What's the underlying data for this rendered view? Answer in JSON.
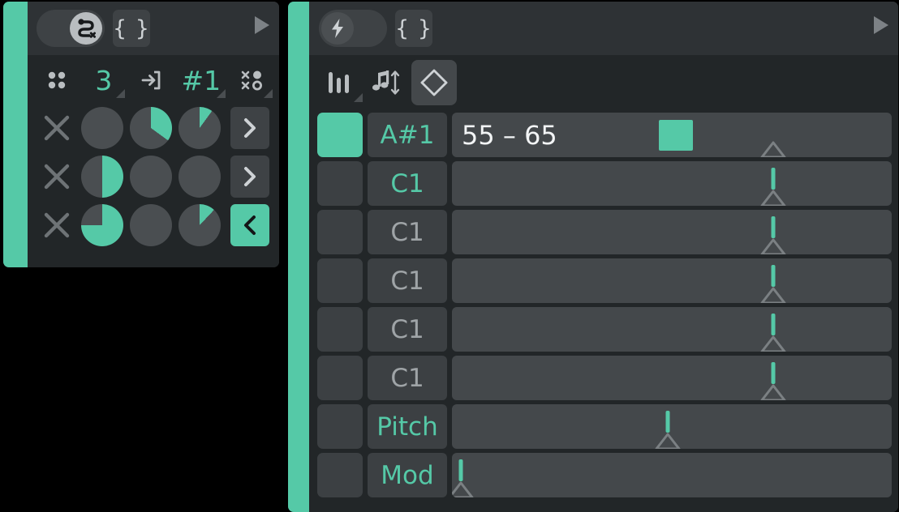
{
  "theme": {
    "accent": "#55c9a7",
    "panel_bg": "#2e3235",
    "body_bg": "#222628",
    "control_bg": "#3e4245",
    "track_bg": "#44484b",
    "text_dim": "#9fa4a7",
    "text_bright": "#f2f4f5",
    "page_bg": "#000000"
  },
  "left_panel": {
    "header": {
      "mod_toggle": {
        "state": "on",
        "icon": "snake-path-x-icon"
      },
      "braces_button": {
        "label": "{ }",
        "icon": "curly-braces-icon"
      },
      "play_button": {
        "icon": "play-triangle-icon"
      }
    },
    "toolbar": [
      {
        "name": "grid",
        "icon": "four-dot-grid-icon",
        "label": "",
        "accent": false
      },
      {
        "name": "count",
        "icon": "",
        "label": "3",
        "accent": true
      },
      {
        "name": "input",
        "icon": "arrow-into-box-icon",
        "label": "",
        "accent": false
      },
      {
        "name": "pattern",
        "icon": "",
        "label": "#1",
        "accent": true
      },
      {
        "name": "randomize",
        "icon": "random-dots-icon",
        "label": "",
        "accent": false
      }
    ],
    "rows": [
      {
        "clear_icon": "close-x-icon",
        "dials": [
          0,
          35,
          10
        ],
        "chevron": {
          "icon": "chevron-right-icon",
          "direction": "right",
          "active": false
        }
      },
      {
        "clear_icon": "close-x-icon",
        "dials": [
          50,
          0,
          0
        ],
        "chevron": {
          "icon": "chevron-right-icon",
          "direction": "right",
          "active": false
        }
      },
      {
        "clear_icon": "close-x-icon",
        "dials": [
          75,
          0,
          12
        ],
        "chevron": {
          "icon": "chevron-left-icon",
          "direction": "left",
          "active": true
        }
      }
    ]
  },
  "right_panel": {
    "header": {
      "lightning_toggle": {
        "state": "off",
        "icon": "lightning-bolt-icon"
      },
      "braces_button": {
        "label": "{ }",
        "icon": "curly-braces-icon"
      },
      "play_button": {
        "icon": "play-triangle-icon"
      }
    },
    "toolbar": [
      {
        "name": "sliders",
        "icon": "vertical-sliders-icon",
        "selected": false,
        "has_corner": true
      },
      {
        "name": "transpose",
        "icon": "note-up-down-icon",
        "selected": false,
        "has_corner": false
      },
      {
        "name": "range",
        "icon": "diamond-updown-icon",
        "selected": true,
        "has_corner": false
      }
    ],
    "rows": [
      {
        "pad_active": true,
        "note": "A#1",
        "note_highlight": true,
        "value_text": "55 – 65",
        "swatch": true,
        "swatch_pos_pct": 47,
        "slider_pct": 73,
        "slider_has_stem": false
      },
      {
        "pad_active": false,
        "note": "C1",
        "note_highlight": true,
        "value_text": "",
        "swatch": false,
        "slider_pct": 73,
        "slider_has_stem": true
      },
      {
        "pad_active": false,
        "note": "C1",
        "note_highlight": false,
        "value_text": "",
        "swatch": false,
        "slider_pct": 73,
        "slider_has_stem": true
      },
      {
        "pad_active": false,
        "note": "C1",
        "note_highlight": false,
        "value_text": "",
        "swatch": false,
        "slider_pct": 73,
        "slider_has_stem": true
      },
      {
        "pad_active": false,
        "note": "C1",
        "note_highlight": false,
        "value_text": "",
        "swatch": false,
        "slider_pct": 73,
        "slider_has_stem": true
      },
      {
        "pad_active": false,
        "note": "C1",
        "note_highlight": false,
        "value_text": "",
        "swatch": false,
        "slider_pct": 73,
        "slider_has_stem": true
      },
      {
        "pad_active": false,
        "note": "Pitch",
        "note_highlight": true,
        "value_text": "",
        "swatch": false,
        "slider_pct": 49,
        "slider_has_stem": true
      },
      {
        "pad_active": false,
        "note": "Mod",
        "note_highlight": true,
        "value_text": "",
        "swatch": false,
        "slider_pct": 2,
        "slider_has_stem": true
      }
    ]
  }
}
